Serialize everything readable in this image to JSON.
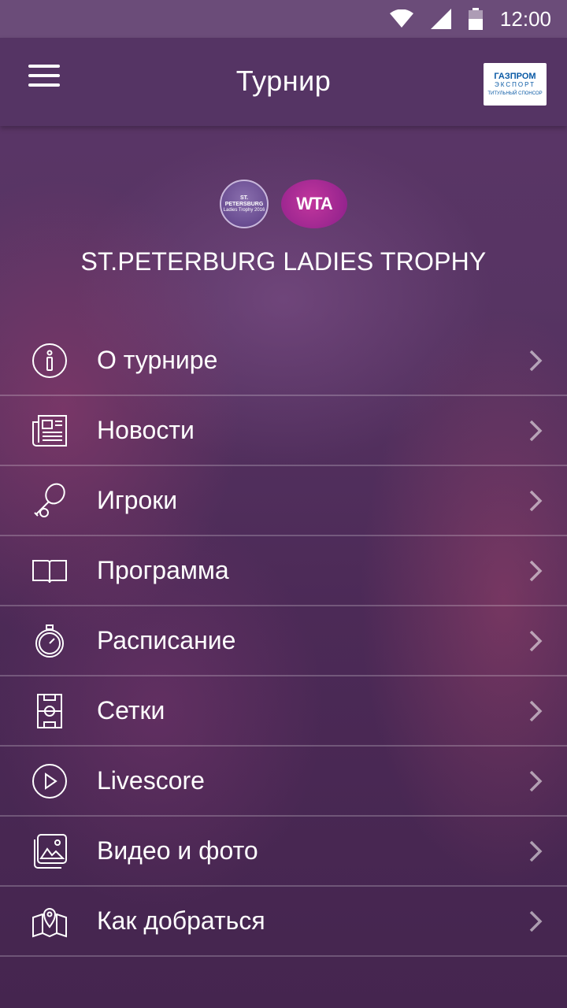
{
  "status_bar": {
    "time": "12:00"
  },
  "app_bar": {
    "title": "Турнир",
    "sponsor": {
      "name": "ГАЗПРОМ",
      "line2": "ЭКСПОРТ",
      "caption": "ТИТУЛЬНЫЙ СПОНСОР",
      "color": "#0a5aa5"
    }
  },
  "logos": {
    "spb": {
      "line1": "ST. PETERSBURG",
      "line2": "Ladies Trophy 2016"
    },
    "wta": "WTA"
  },
  "tournament_title": "ST.PETERBURG LADIES TROPHY",
  "menu": [
    {
      "label": "О турнире",
      "icon": "info-icon"
    },
    {
      "label": "Новости",
      "icon": "newspaper-icon"
    },
    {
      "label": "Игроки",
      "icon": "tennis-racket-icon"
    },
    {
      "label": "Программа",
      "icon": "book-icon"
    },
    {
      "label": "Расписание",
      "icon": "stopwatch-icon"
    },
    {
      "label": "Сетки",
      "icon": "court-icon"
    },
    {
      "label": "Livescore",
      "icon": "play-icon"
    },
    {
      "label": "Видео и фото",
      "icon": "gallery-icon"
    },
    {
      "label": "Как добраться",
      "icon": "map-pin-icon"
    }
  ]
}
